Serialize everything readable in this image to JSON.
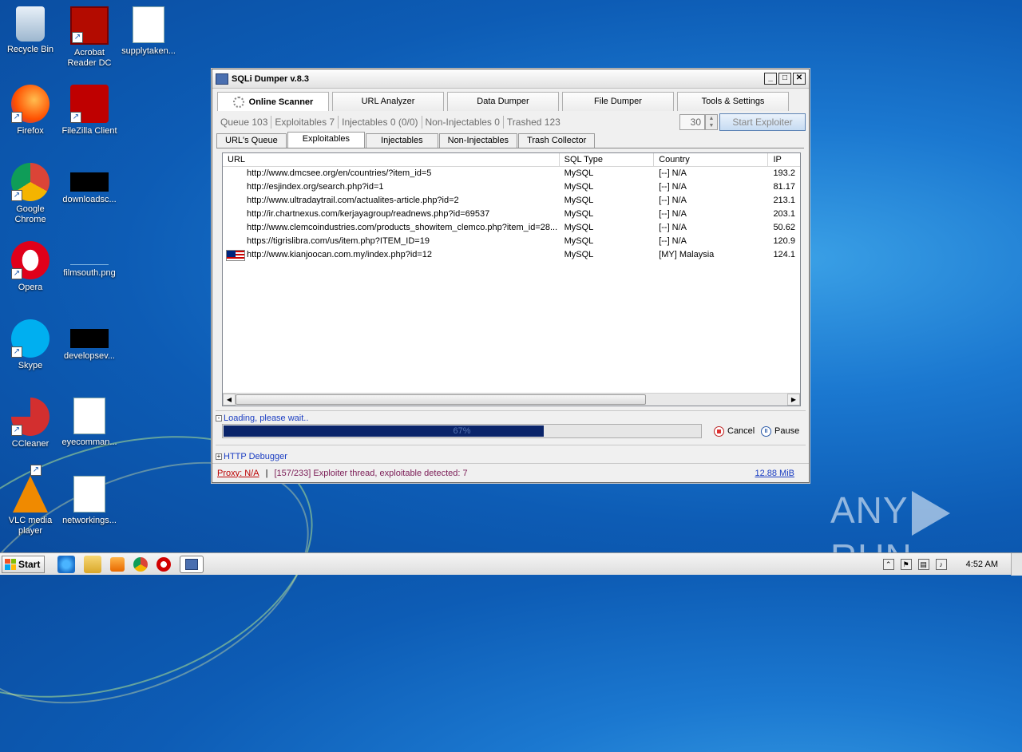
{
  "desktop": {
    "icons": [
      {
        "label": "Recycle Bin",
        "name": "recycle-bin-icon"
      },
      {
        "label": "Acrobat Reader DC",
        "name": "acrobat-reader-icon"
      },
      {
        "label": "supplytaken...",
        "name": "word-document-icon"
      },
      {
        "label": "Firefox",
        "name": "firefox-icon"
      },
      {
        "label": "FileZilla Client",
        "name": "filezilla-icon"
      },
      {
        "label": "Google Chrome",
        "name": "chrome-icon"
      },
      {
        "label": "downloadsc...",
        "name": "image-file-icon"
      },
      {
        "label": "Opera",
        "name": "opera-icon"
      },
      {
        "label": "filmsouth.png",
        "name": "png-file-icon"
      },
      {
        "label": "Skype",
        "name": "skype-icon"
      },
      {
        "label": "developsev...",
        "name": "image-file-icon"
      },
      {
        "label": "CCleaner",
        "name": "ccleaner-icon"
      },
      {
        "label": "eyecomman...",
        "name": "word-document-icon"
      },
      {
        "label": "VLC media player",
        "name": "vlc-icon"
      },
      {
        "label": "networkings...",
        "name": "word-document-icon"
      }
    ]
  },
  "window": {
    "title": "SQLi Dumper v.8.3",
    "main_tabs": [
      "Online Scanner",
      "URL Analyzer",
      "Data Dumper",
      "File Dumper",
      "Tools & Settings"
    ],
    "stats": {
      "queue": "Queue 103",
      "exploitables": "Exploitables 7",
      "injectables": "Injectables 0 (0/0)",
      "non_injectables": "Non-Injectables 0",
      "trashed": "Trashed 123"
    },
    "threads": "30",
    "start_button": "Start Exploiter",
    "sub_tabs": [
      "URL's Queue",
      "Exploitables",
      "Injectables",
      "Non-Injectables",
      "Trash Collector"
    ],
    "grid": {
      "columns": [
        "URL",
        "SQL Type",
        "Country",
        "IP"
      ],
      "rows": [
        {
          "url": "http://www.dmcsee.org/en/countries/?item_id=5",
          "sql": "MySQL",
          "country": "[--] N/A",
          "ip": "193.2"
        },
        {
          "url": "http://esjindex.org/search.php?id=1",
          "sql": "MySQL",
          "country": "[--] N/A",
          "ip": "81.17"
        },
        {
          "url": "http://www.ultradaytrail.com/actualites-article.php?id=2",
          "sql": "MySQL",
          "country": "[--] N/A",
          "ip": "213.1"
        },
        {
          "url": "http://ir.chartnexus.com/kerjayagroup/readnews.php?id=69537",
          "sql": "MySQL",
          "country": "[--] N/A",
          "ip": "203.1"
        },
        {
          "url": "http://www.clemcoindustries.com/products_showitem_clemco.php?item_id=28...",
          "sql": "MySQL",
          "country": "[--] N/A",
          "ip": "50.62"
        },
        {
          "url": "https://tigrislibra.com/us/item.php?ITEM_ID=19",
          "sql": "MySQL",
          "country": "[--] N/A",
          "ip": "120.9"
        },
        {
          "url": "http://www.kianjoocan.com.my/index.php?id=12",
          "sql": "MySQL",
          "country": "[MY] Malaysia",
          "ip": "124.1",
          "flag": true
        }
      ]
    },
    "loading_text": "Loading, please wait..",
    "progress": {
      "percent": 67,
      "label": "67%"
    },
    "cancel_label": "Cancel",
    "pause_label": "Pause",
    "http_debugger": "HTTP Debugger",
    "status": {
      "proxy": "Proxy: N/A",
      "separator": "|",
      "message": "[157/233] Exploiter thread, exploitable detected: 7",
      "memory": "12.88 MiB"
    }
  },
  "taskbar": {
    "start": "Start",
    "clock": "4:52 AM"
  },
  "watermark": {
    "left": "ANY",
    "right": "RUN"
  }
}
